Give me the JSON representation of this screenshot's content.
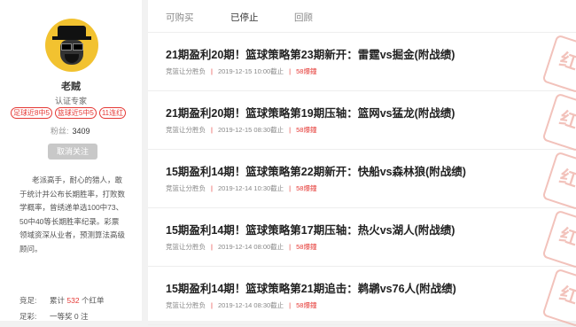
{
  "profile": {
    "name": "老贼",
    "title": "认证专家",
    "tags": [
      "足球近8中5",
      "篮球近5中5",
      "11连红"
    ],
    "fans_label": "粉丝:",
    "fans_count": "3409",
    "unfollow_label": "取消关注",
    "bio": "老派高手，耐心的猎人，敢于统计并公布长期胜率，打败数学概率，曾绣递单选100中73、50中40等长期胜率纪录。彩票领域资深从业者，预测算法高级顾问。",
    "stats": [
      {
        "label": "竞足:",
        "prefix": "累计",
        "value": "532",
        "suffix": "个红单"
      },
      {
        "label": "足彩:",
        "prefix": "一等奖",
        "value": "0",
        "suffix": "注"
      }
    ]
  },
  "tabs": [
    {
      "label": "可购买",
      "active": false
    },
    {
      "label": "已停止",
      "active": true
    },
    {
      "label": "回顾",
      "active": false
    }
  ],
  "items": [
    {
      "title": "21期盈利20期！篮球策略第23期新开：雷霆vs掘金(附战绩)",
      "category": "竞篮让分胜负",
      "time": "2019-12-15 10:00截止",
      "status": "58爆鐘",
      "stamp": "红"
    },
    {
      "title": "21期盈利20期！篮球策略第19期压轴：篮网vs猛龙(附战绩)",
      "category": "竞篮让分胜负",
      "time": "2019-12-15 08:30截止",
      "status": "58爆鐘",
      "stamp": "红"
    },
    {
      "title": "15期盈利14期！篮球策略第22期新开：快船vs森林狼(附战绩)",
      "category": "竞篮让分胜负",
      "time": "2019-12-14 10:30截止",
      "status": "58爆鐘",
      "stamp": "红"
    },
    {
      "title": "15期盈利14期！篮球策略第17期压轴：热火vs湖人(附战绩)",
      "category": "竞篮让分胜负",
      "time": "2019-12-14 08:00截止",
      "status": "58爆鐘",
      "stamp": "红"
    },
    {
      "title": "15期盈利14期！篮球策略第21期追击：鹈鹕vs76人(附战绩)",
      "category": "竞篮让分胜负",
      "time": "2019-12-14 08:30截止",
      "status": "58爆鐘",
      "stamp": "红"
    }
  ],
  "colors": {
    "accent_red": "#e53935",
    "stamp_red": "#f0b8b0",
    "avatar_yellow": "#f2c230"
  }
}
